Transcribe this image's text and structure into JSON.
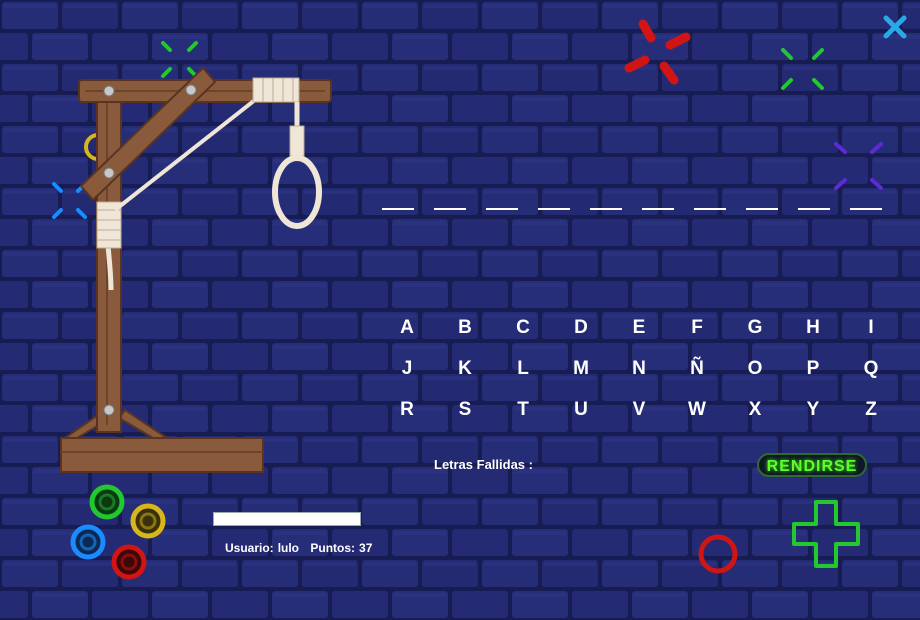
{
  "title": "",
  "word": {
    "slots": [
      "",
      "",
      "",
      "",
      "",
      "",
      "",
      "",
      "",
      ""
    ]
  },
  "alphabet": [
    "A",
    "B",
    "C",
    "D",
    "E",
    "F",
    "G",
    "H",
    "I",
    "J",
    "K",
    "L",
    "M",
    "N",
    "Ñ",
    "O",
    "P",
    "Q",
    "R",
    "S",
    "T",
    "U",
    "V",
    "W",
    "X",
    "Y",
    "Z"
  ],
  "failed_label": "Letras Fallidas :",
  "failed_letters": "",
  "surrender_label": "RENDIRSE",
  "progress_fraction": 1.0,
  "user": {
    "label": "Usuario:",
    "name": "lulo",
    "points_label": "Puntos:",
    "points": "37"
  },
  "colors": {
    "background": "#1e2463",
    "surrender_text": "#5cff2b",
    "neon_green": "#22c82e",
    "neon_red": "#d11515",
    "neon_blue": "#1a8cff",
    "neon_yellow": "#d6b61a",
    "neon_purple": "#5a2bd6"
  },
  "icons": {
    "close": "close-x-icon"
  }
}
